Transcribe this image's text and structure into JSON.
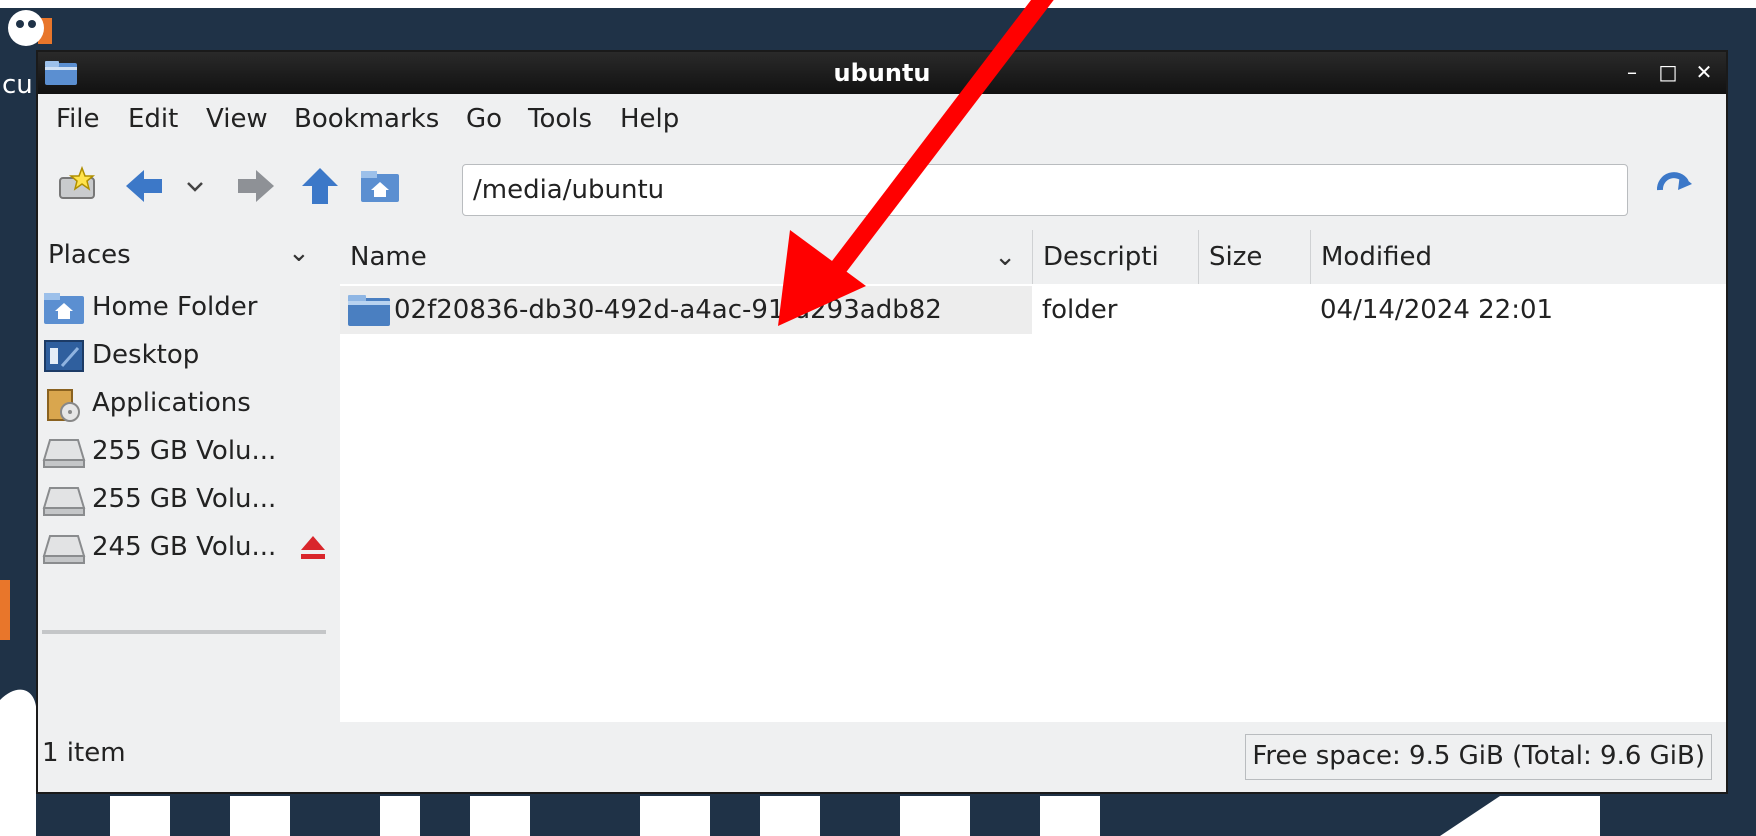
{
  "window": {
    "title": "ubuntu",
    "controls": {
      "minimize": "–",
      "maximize": "□",
      "close": "✕"
    }
  },
  "desktop": {
    "label": "cu"
  },
  "menu": [
    "File",
    "Edit",
    "View",
    "Bookmarks",
    "Go",
    "Tools",
    "Help"
  ],
  "toolbar": {
    "location": "/media/ubuntu",
    "icons": [
      "new-bookmark-icon",
      "back-arrow-icon",
      "history-dropdown-icon",
      "forward-arrow-icon",
      "up-arrow-icon",
      "home-folder-icon",
      "go-reload-icon"
    ]
  },
  "places": {
    "header": "Places",
    "items": [
      {
        "label": "Home Folder",
        "icon": "home-folder-icon"
      },
      {
        "label": "Desktop",
        "icon": "desktop-icon"
      },
      {
        "label": "Applications",
        "icon": "applications-icon"
      },
      {
        "label": "255 GB Volu...",
        "icon": "drive-icon"
      },
      {
        "label": "255 GB Volu...",
        "icon": "drive-icon"
      },
      {
        "label": "245 GB Volu...",
        "icon": "drive-icon",
        "eject": true
      }
    ]
  },
  "list": {
    "columns": [
      "Name",
      "Descripti",
      "Size",
      "Modified"
    ],
    "rows": [
      {
        "name": "02f20836-db30-492d-a4ac-91fd293adb82",
        "description": "folder",
        "size": "",
        "modified": "04/14/2024 22:01"
      }
    ]
  },
  "status": {
    "count": "1 item",
    "space": "Free space: 9.5 GiB (Total: 9.6 GiB)"
  },
  "colors": {
    "annotation_arrow": "#ff0000",
    "folder_blue": "#4a7fc1",
    "desktop_bg": "#1f3247"
  }
}
